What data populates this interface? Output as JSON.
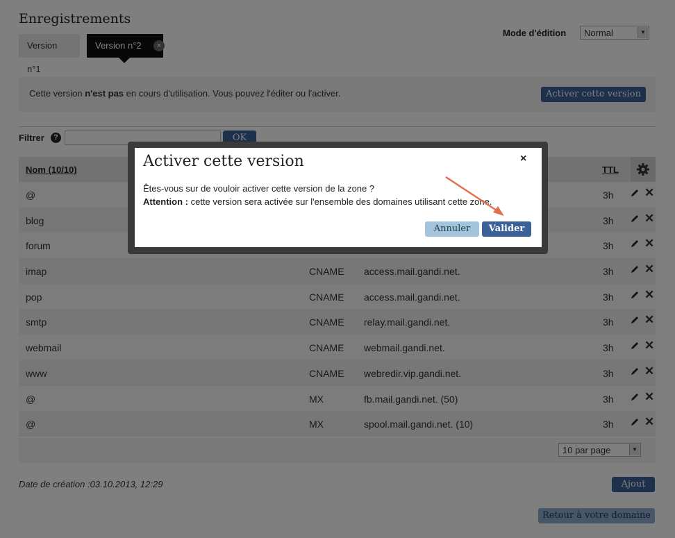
{
  "page": {
    "title": "Enregistrements",
    "tabs": [
      {
        "label": "Version n°1"
      },
      {
        "label": "Version n°2",
        "close": "×"
      }
    ],
    "mode_label": "Mode d'édition",
    "mode_value": "Normal"
  },
  "info": {
    "before": "Cette version ",
    "bold": "n'est pas",
    "after": " en cours d'utilisation. Vous pouvez l'éditer ou l'activer.",
    "activate_label": "Activer cette version"
  },
  "filter": {
    "label": "Filtrer",
    "help": "?",
    "ok_label": "OK"
  },
  "table": {
    "headers": {
      "name": "Nom (10/10)",
      "ttl": "TTL"
    },
    "rows": [
      {
        "name": "@",
        "type": "",
        "value": "",
        "ttl": "3h"
      },
      {
        "name": "blog",
        "type": "",
        "value": "",
        "ttl": "3h"
      },
      {
        "name": "forum",
        "type": "",
        "value": "",
        "ttl": "3h"
      },
      {
        "name": "imap",
        "type": "CNAME",
        "value": "access.mail.gandi.net.",
        "ttl": "3h"
      },
      {
        "name": "pop",
        "type": "CNAME",
        "value": "access.mail.gandi.net.",
        "ttl": "3h"
      },
      {
        "name": "smtp",
        "type": "CNAME",
        "value": "relay.mail.gandi.net.",
        "ttl": "3h"
      },
      {
        "name": "webmail",
        "type": "CNAME",
        "value": "webmail.gandi.net.",
        "ttl": "3h"
      },
      {
        "name": "www",
        "type": "CNAME",
        "value": "webredir.vip.gandi.net.",
        "ttl": "3h"
      },
      {
        "name": "@",
        "type": "MX",
        "value": "fb.mail.gandi.net. (50)",
        "ttl": "3h"
      },
      {
        "name": "@",
        "type": "MX",
        "value": "spool.mail.gandi.net. (10)",
        "ttl": "3h"
      }
    ],
    "per_page": "10 par page"
  },
  "footer": {
    "creation_date": "Date de création :03.10.2013, 12:29",
    "add_label": "Ajout",
    "back_label": "Retour à votre domaine"
  },
  "modal": {
    "title": "Activer cette version",
    "close": "×",
    "line1": "Êtes-vous sur de vouloir activer cette version de la zone ?",
    "warning_bold": "Attention :",
    "warning_text": " cette version sera activée sur l'ensemble des domaines utilisant cette zone.",
    "cancel_label": "Annuler",
    "validate_label": "Valider"
  },
  "colors": {
    "primary": "#3b6298",
    "secondary": "#a4c3dd",
    "arrow": "#e0714f"
  }
}
